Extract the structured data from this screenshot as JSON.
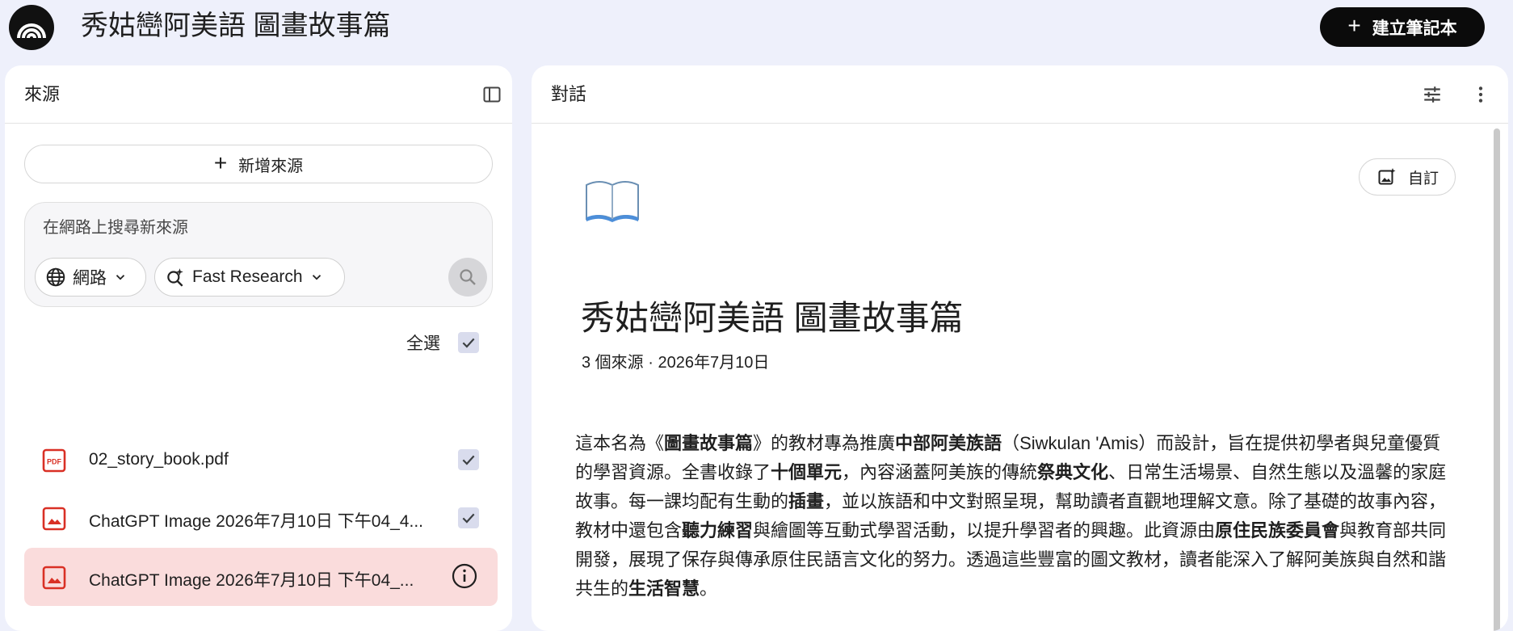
{
  "app": {
    "title": "秀姑巒阿美語 圖畫故事篇",
    "create_notebook_label": "建立筆記本"
  },
  "sources_panel": {
    "title": "來源",
    "add_source_label": "新增來源",
    "search_placeholder": "在網路上搜尋新來源",
    "web_chip_label": "網路",
    "research_chip_label": "Fast Research",
    "select_all_label": "全選",
    "select_all_checked": true,
    "items": [
      {
        "name": "02_story_book.pdf",
        "type": "pdf-icon",
        "checked": true
      },
      {
        "name": "ChatGPT Image 2026年7月10日 下午04_4...",
        "type": "image-icon",
        "checked": true
      },
      {
        "name": "ChatGPT Image 2026年7月10日 下午04_...",
        "type": "image-icon",
        "checked": false,
        "active": true
      }
    ]
  },
  "chat_panel": {
    "title": "對話",
    "customize_label": "自訂",
    "emoji": "book-open-icon",
    "doc_title": "秀姑巒阿美語 圖畫故事篇",
    "doc_meta": "3 個來源 · 2026年7月10日",
    "summary": [
      {
        "t": "這本名為《",
        "b": false
      },
      {
        "t": "圖畫故事篇",
        "b": true
      },
      {
        "t": "》的教材專為推廣",
        "b": false
      },
      {
        "t": "中部阿美族語",
        "b": true
      },
      {
        "t": "（Siwkulan 'Amis）而設計，旨在提供初學者與兒童優質的學習資源。全書收錄了",
        "b": false
      },
      {
        "t": "十個單元",
        "b": true
      },
      {
        "t": "，內容涵蓋阿美族的傳統",
        "b": false
      },
      {
        "t": "祭典文化",
        "b": true
      },
      {
        "t": "、日常生活場景、自然生態以及溫馨的家庭故事。每一課均配有生動的",
        "b": false
      },
      {
        "t": "插畫",
        "b": true
      },
      {
        "t": "，並以族語和中文對照呈現，幫助讀者直觀地理解文意。除了基礎的故事內容，教材中還包含",
        "b": false
      },
      {
        "t": "聽力練習",
        "b": true
      },
      {
        "t": "與繪圖等互動式學習活動，以提升學習者的興趣。此資源由",
        "b": false
      },
      {
        "t": "原住民族委員會",
        "b": true
      },
      {
        "t": "與教育部共同開發，展現了保存與傳承原住民語言文化的努力。透過這些豐富的圖文教材，讀者能深入了解阿美族與自然和諧共生的",
        "b": false
      },
      {
        "t": "生活智慧",
        "b": true
      },
      {
        "t": "。",
        "b": false
      }
    ]
  },
  "colors": {
    "background": "#eef0fb",
    "active_source": "#fadcdc",
    "source_icon_red": "#d93025",
    "checkbox_fill": "#d9dced"
  }
}
